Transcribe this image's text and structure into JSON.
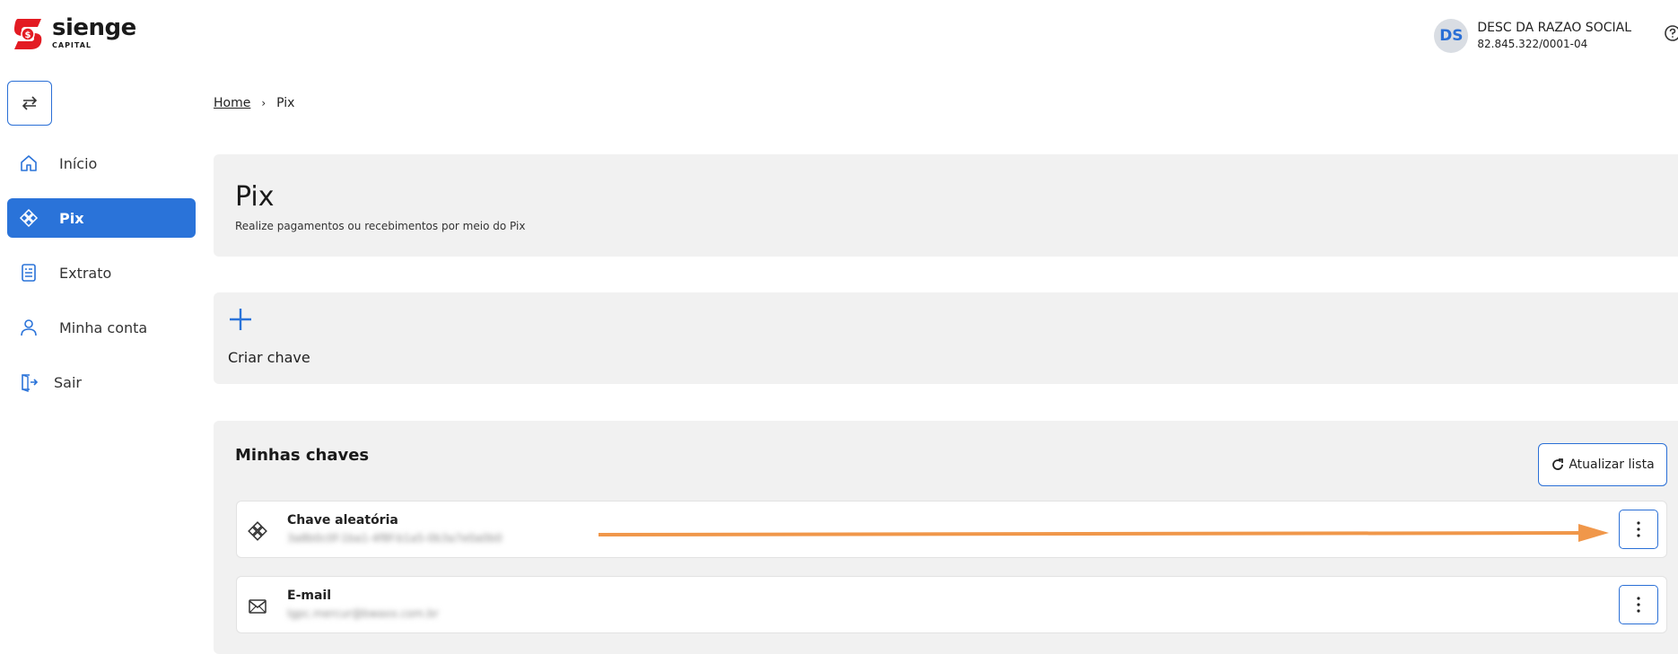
{
  "brand": {
    "name": "sienge",
    "sub": "CAPITAL",
    "color": "#e31b23"
  },
  "accent": "#2a73d9",
  "user": {
    "initials": "DS",
    "name": "DESC DA RAZAO SOCIAL",
    "document": "82.845.322/0001-04"
  },
  "icons": {
    "switch": "swap-arrows-icon",
    "help": "help-icon"
  },
  "nav": [
    {
      "label": "Início",
      "icon": "home-icon",
      "active": false
    },
    {
      "label": "Pix",
      "icon": "pix-icon",
      "active": true
    },
    {
      "label": "Extrato",
      "icon": "statement-icon",
      "active": false
    },
    {
      "label": "Minha conta",
      "icon": "user-icon",
      "active": false
    },
    {
      "label": "Sair",
      "icon": "logout-icon",
      "active": false
    }
  ],
  "breadcrumb": {
    "home": "Home",
    "separator": "›",
    "current": "Pix"
  },
  "page": {
    "title": "Pix",
    "subtitle": "Realize pagamentos ou recebimentos por meio do Pix"
  },
  "create": {
    "label": "Criar chave"
  },
  "keys": {
    "title": "Minhas chaves",
    "refresh_label": "Atualizar lista",
    "items": [
      {
        "type": "Chave aleatória",
        "value": "3a8b0c0f-1ba1-4f8f-b1a5-0b3a7e0a0b0",
        "icon": "pix-icon"
      },
      {
        "type": "E-mail",
        "value": "lgpc.mercur@bwaxx.com.br",
        "icon": "email-icon"
      }
    ]
  }
}
